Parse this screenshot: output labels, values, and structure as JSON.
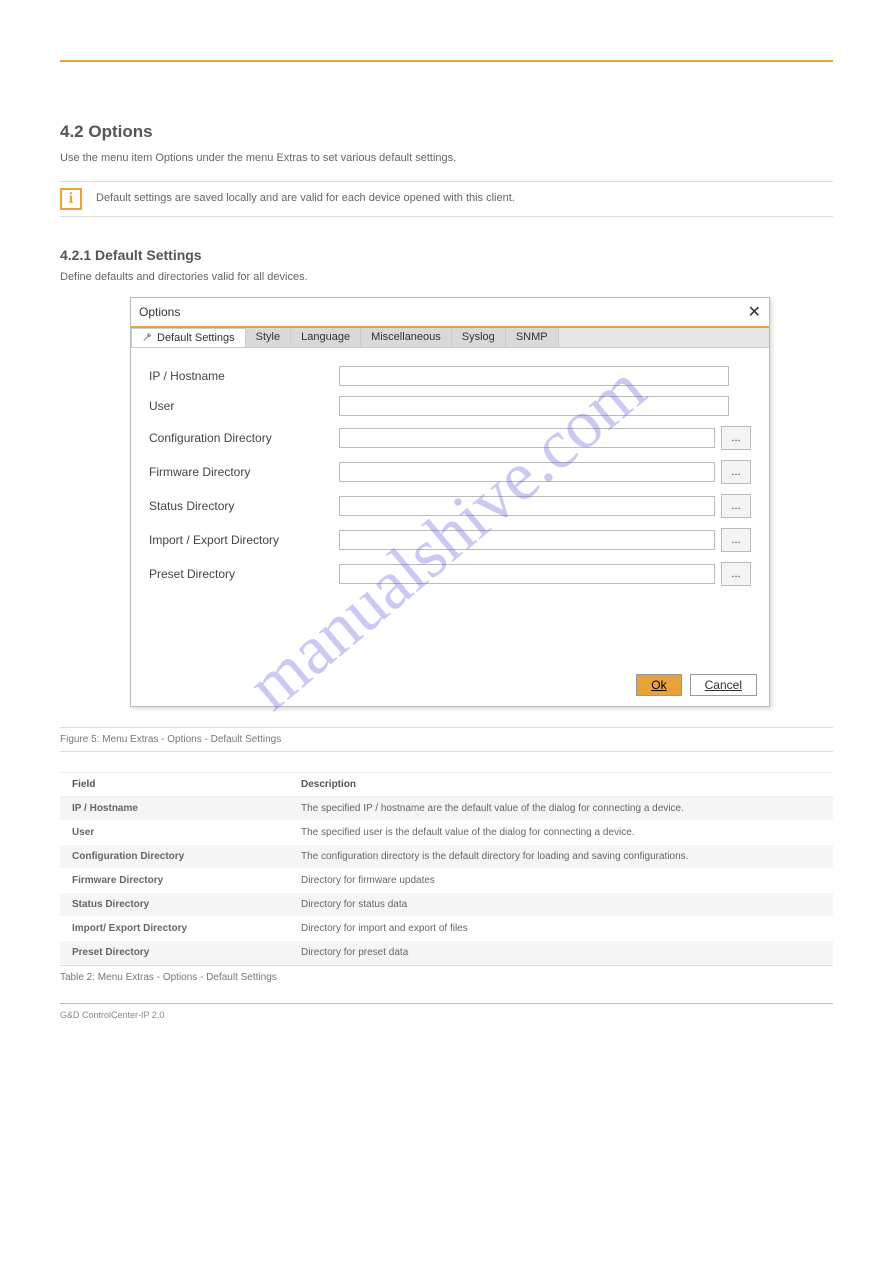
{
  "section": {
    "heading": "4.2 Options",
    "sub": "Use the menu item Options under the menu Extras to set various default settings."
  },
  "info": {
    "glyph": "i",
    "text": "Default settings are saved locally and are valid for each device opened with this client."
  },
  "default_settings": {
    "heading": "4.2.1 Default Settings",
    "sub": "Define defaults and directories valid for all devices."
  },
  "dialog": {
    "title": "Options",
    "close": "✕",
    "tabs": [
      "Default Settings",
      "Style",
      "Language",
      "Miscellaneous",
      "Syslog",
      "SNMP"
    ],
    "fields": {
      "ip": {
        "label": "IP / Hostname"
      },
      "user": {
        "label": "User"
      },
      "cfgdir": {
        "label": "Configuration Directory"
      },
      "fwdir": {
        "label": "Firmware Directory"
      },
      "stdir": {
        "label": "Status Directory"
      },
      "iedir": {
        "label": "Import / Export Directory"
      },
      "predir": {
        "label": "Preset Directory"
      }
    },
    "browse": "...",
    "ok": "Ok",
    "cancel": "Cancel"
  },
  "figure_caption": "Figure 5: Menu Extras - Options - Default Settings",
  "table": {
    "header_field": "Field",
    "header_desc": "Description",
    "rows": [
      {
        "field": "IP / Hostname",
        "desc": "The specified IP / hostname are the default value of the dialog for connecting a device."
      },
      {
        "field": "User",
        "desc": "The specified user is the default value of the dialog for connecting a device."
      },
      {
        "field": "Configuration Directory",
        "desc": "The configuration directory is the default directory for loading and saving configurations."
      },
      {
        "field": "Firmware Directory",
        "desc": "Directory for firmware updates"
      },
      {
        "field": "Status Directory",
        "desc": "Directory for status data"
      },
      {
        "field": "Import/ Export Directory",
        "desc": "Directory for import and export of files"
      },
      {
        "field": "Preset Directory",
        "desc": "Directory for preset data"
      }
    ]
  },
  "table_caption": "Table 2: Menu Extras - Options - Default Settings",
  "footer": "G&D ControlCenter-IP 2.0",
  "watermark": "manualshive.com"
}
